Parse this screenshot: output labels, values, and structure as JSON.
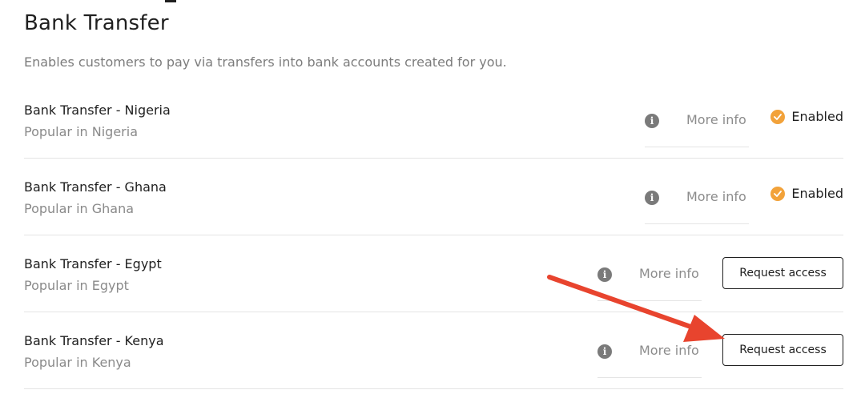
{
  "page": {
    "title": "Bank Transfer",
    "subtitle": "Enables customers to pay via transfers into bank accounts created for you."
  },
  "methods": [
    {
      "name": "Bank Transfer - Nigeria",
      "description": "Popular in Nigeria",
      "more_info": "More info",
      "status": "Enabled",
      "action": ""
    },
    {
      "name": "Bank Transfer - Ghana",
      "description": "Popular in Ghana",
      "more_info": "More info",
      "status": "Enabled",
      "action": ""
    },
    {
      "name": "Bank Transfer - Egypt",
      "description": "Popular in Egypt",
      "more_info": "More info",
      "status": "",
      "action": "Request access"
    },
    {
      "name": "Bank Transfer - Kenya",
      "description": "Popular in Kenya",
      "more_info": "More info",
      "status": "",
      "action": "Request access"
    }
  ],
  "icons": {
    "info": "info-icon",
    "enabled": "check-circle-icon",
    "annotation": "red-arrow-annotation"
  },
  "colors": {
    "enabled_accent": "#f2a23a",
    "annotation_arrow": "#e8442e",
    "muted_text": "#8a8a8a"
  }
}
